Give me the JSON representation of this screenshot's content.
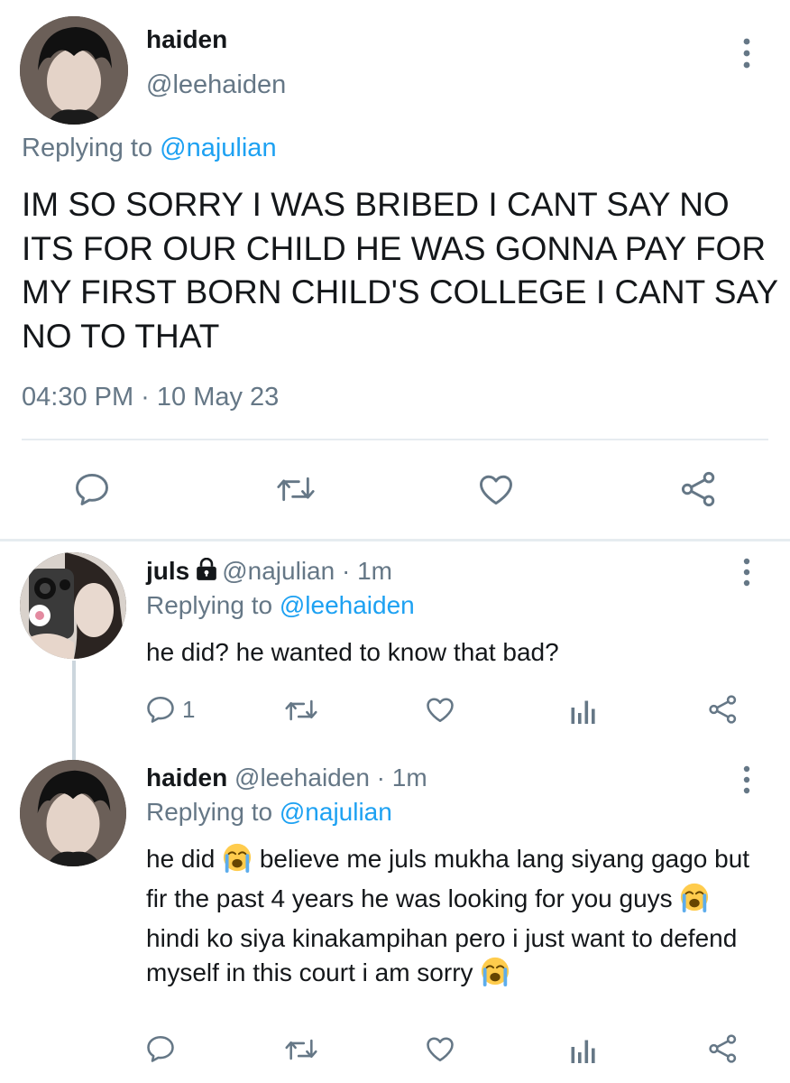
{
  "main_tweet": {
    "display_name": "haiden",
    "handle": "@leehaiden",
    "replying_prefix": "Replying to",
    "replying_to": "@najulian",
    "text": "IM SO SORRY I WAS BRIBED I CANT SAY NO ITS FOR OUR CHILD HE WAS GONNA PAY FOR MY FIRST BORN CHILD'S COLLEGE I CANT SAY NO TO THAT",
    "timestamp": "04:30 PM · 10 May 23",
    "actions": [
      "reply-icon",
      "retweet-icon",
      "like-icon",
      "share-icon"
    ]
  },
  "replies": [
    {
      "display_name": "juls",
      "locked": true,
      "handle": "@najulian",
      "time": "· 1m",
      "replying_prefix": "Replying to",
      "replying_to": "@leehaiden",
      "text": "he did? he wanted to know that bad?",
      "reply_count": "1"
    },
    {
      "display_name": "haiden",
      "handle": "@leehaiden",
      "time": "· 1m",
      "replying_prefix": "Replying to",
      "replying_to": "@najulian",
      "text_part1": "he did",
      "text_part2": " believe me juls mukha lang siyang gago but fir the past 4 years he was looking for you guys",
      "text_part3": " hindi ko siya kinakampihan pero i just want to defend myself in this court i am sorry",
      "emoji": "loudly-crying-face-emoji"
    }
  ],
  "colors": {
    "text": "#14171a",
    "secondary": "#657786",
    "link": "#1da1f2",
    "divider": "#e6ecf0"
  }
}
